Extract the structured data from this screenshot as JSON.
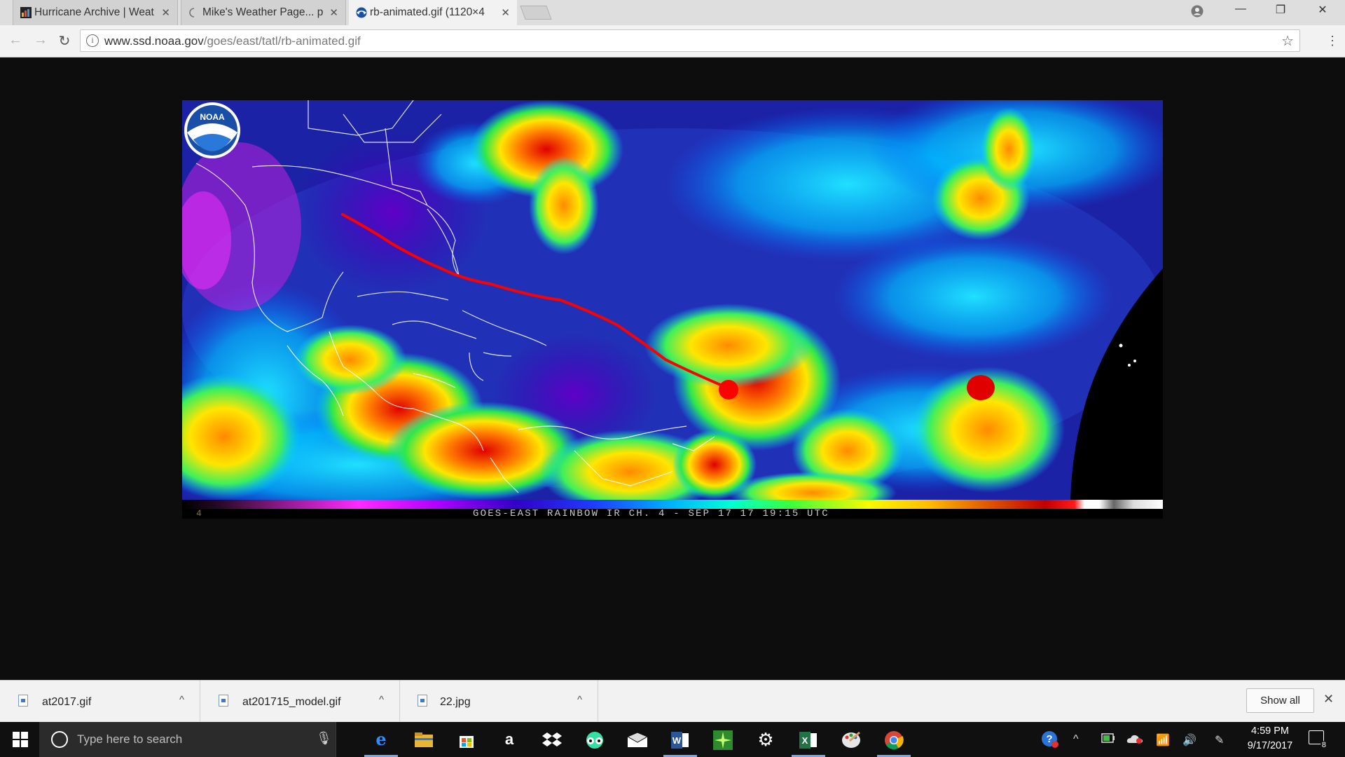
{
  "browser": {
    "tabs": [
      {
        "label": "Hurricane Archive | Weat",
        "favicon": "wu-icon"
      },
      {
        "label": "Mike's Weather Page... p",
        "favicon": "loading-icon"
      },
      {
        "label": "rb-animated.gif (1120×4",
        "favicon": "noaa-icon"
      }
    ],
    "url_host": "www.ssd.noaa.gov",
    "url_path": "/goes/east/tatl/rb-animated.gif"
  },
  "image": {
    "logo_text": "NOAA",
    "channel_mark": "4",
    "caption": "GOES-EAST RAINBOW IR CH. 4  - SEP 17 17 19:15 UTC",
    "track_color": "#ff0000"
  },
  "downloads": {
    "items": [
      {
        "name": "at2017.gif"
      },
      {
        "name": "at201715_model.gif"
      },
      {
        "name": "22.jpg"
      }
    ],
    "show_all": "Show all"
  },
  "taskbar": {
    "search_placeholder": "Type here to search",
    "apps": [
      "edge-icon",
      "file-explorer-icon",
      "store-icon",
      "amazon-icon",
      "dropbox-icon",
      "tripadvisor-icon",
      "mail-icon",
      "word-icon",
      "app-green-icon",
      "settings-icon",
      "excel-icon",
      "paint-icon",
      "chrome-icon"
    ],
    "time": "4:59 PM",
    "date": "9/17/2017",
    "notification_count": "8"
  }
}
